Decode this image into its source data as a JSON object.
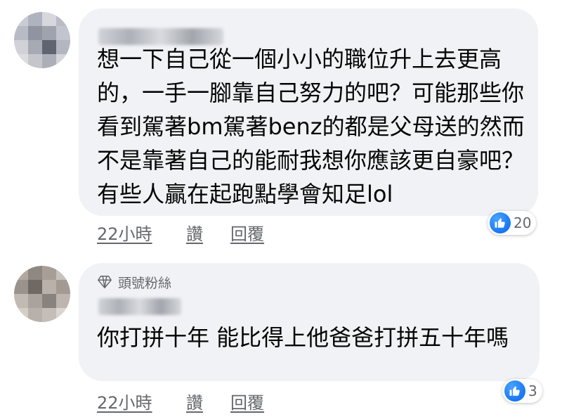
{
  "comments": [
    {
      "text": "想一下自己從一個小小的職位升上去更高的，一手一腳靠自己努力的吧？可能那些你看到駕著bm駕著benz的都是父母送的然而不是靠著自己的能耐我想你應該更自豪吧？有些人贏在起跑點學會知足lol",
      "time": "22小時",
      "like_label": "讚",
      "reply_label": "回覆",
      "reaction_count": "20"
    },
    {
      "badge": "頭號粉絲",
      "text": "你打拼十年 能比得上他爸爸打拼五十年嗎",
      "time": "22小時",
      "like_label": "讚",
      "reply_label": "回覆",
      "reaction_count": "3"
    }
  ],
  "icons": {
    "reaction": "like-icon",
    "badge": "diamond-icon"
  },
  "colors": {
    "bubble": "#f0f2f5",
    "like_blue": "#1877f2",
    "meta_text": "#65676b"
  }
}
